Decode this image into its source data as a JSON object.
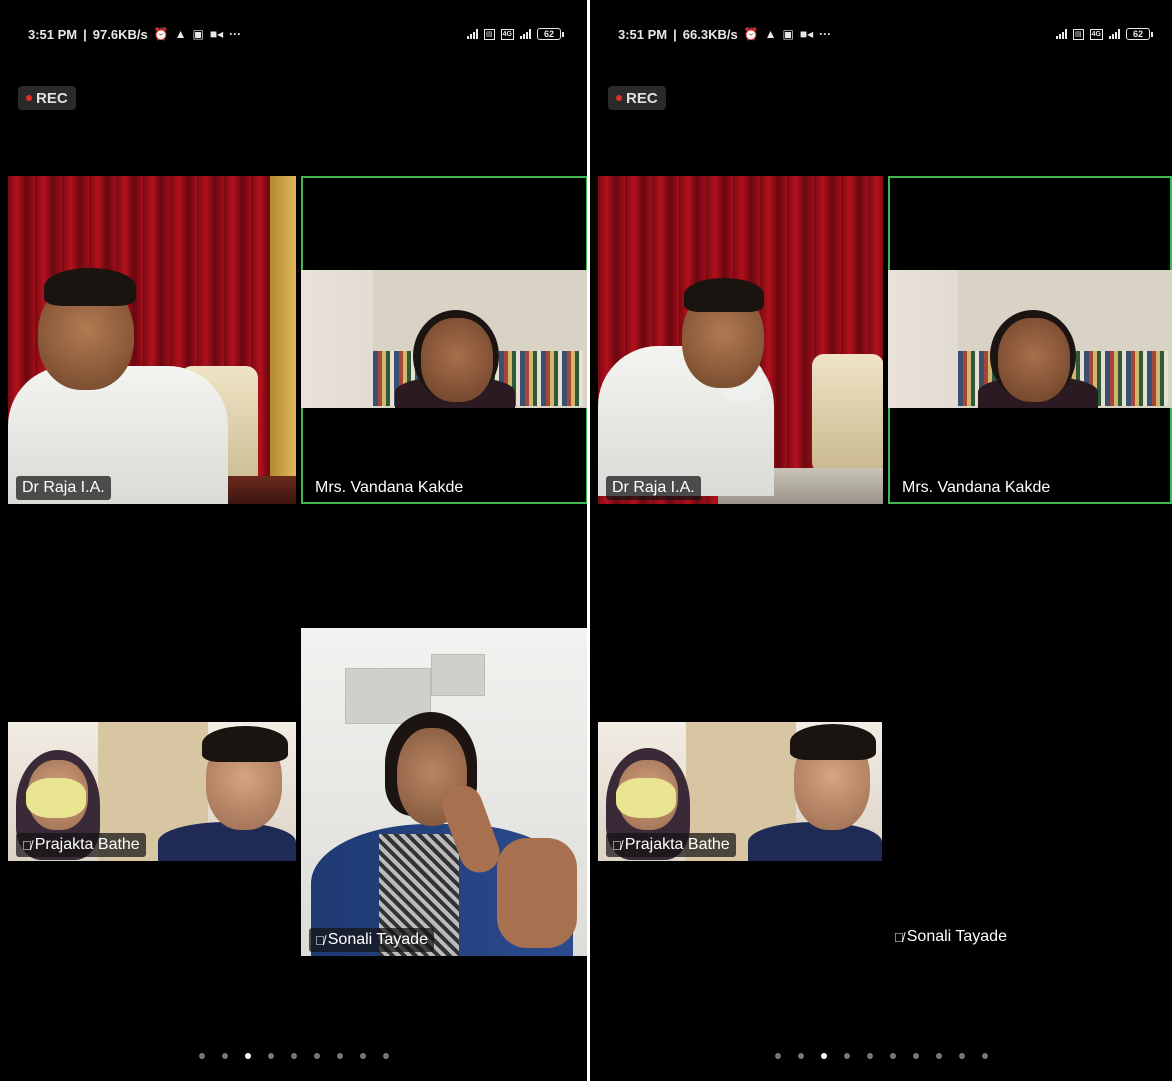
{
  "screens": [
    {
      "status": {
        "time": "3:51 PM",
        "speed": "97.6KB/s",
        "battery": "62",
        "net": "4G"
      },
      "rec_label": "REC",
      "participants": {
        "raja": "Dr Raja I.A.",
        "vandana": "Mrs. Vandana Kakde",
        "prajakta": "Prajakta Bathe",
        "sonali": "Sonali Tayade"
      },
      "pagination": {
        "count": 9,
        "active": 2
      }
    },
    {
      "status": {
        "time": "3:51 PM",
        "speed": "66.3KB/s",
        "battery": "62",
        "net": "4G"
      },
      "rec_label": "REC",
      "participants": {
        "raja": "Dr Raja I.A.",
        "vandana": "Mrs. Vandana Kakde",
        "prajakta": "Prajakta Bathe",
        "sonali": "Sonali Tayade"
      },
      "pagination": {
        "count": 10,
        "active": 2
      }
    }
  ],
  "colors": {
    "active_speaker": "#3fb94f",
    "rec_dot": "#e0312b"
  },
  "icons": {
    "muted": "mic-muted-icon",
    "alarm": "alarm-icon",
    "warning": "warning-icon",
    "message": "message-icon",
    "video": "video-icon",
    "more": "more-icon"
  }
}
